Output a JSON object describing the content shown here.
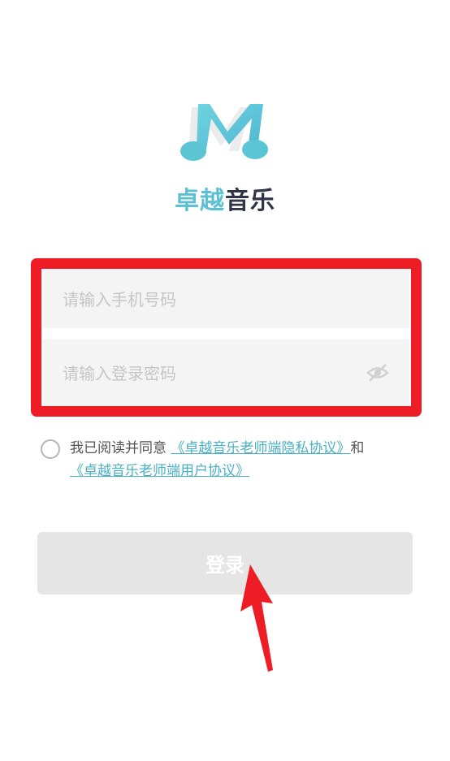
{
  "app": {
    "brand_part1": "卓越",
    "brand_part2": "音乐",
    "logo_icon": "music-note-m-logo",
    "accent_color": "#5cc0d2",
    "dark_color": "#2f3447"
  },
  "form": {
    "phone_placeholder": "请输入手机号码",
    "password_placeholder": "请输入登录密码",
    "password_toggle_icon": "eye-hidden-icon",
    "highlight_color": "#ee1c25"
  },
  "agreement": {
    "prefix": "我已阅读并同意",
    "privacy_link": "《卓越音乐老师端隐私协议》",
    "conjunction": "和",
    "user_link": "《卓越音乐老师端用户协议》",
    "checked": false
  },
  "login": {
    "label": "登录",
    "background": "#e5e5e5"
  },
  "annotation": {
    "arrow_icon": "red-arrow-pointer",
    "color": "#ee1c25"
  }
}
